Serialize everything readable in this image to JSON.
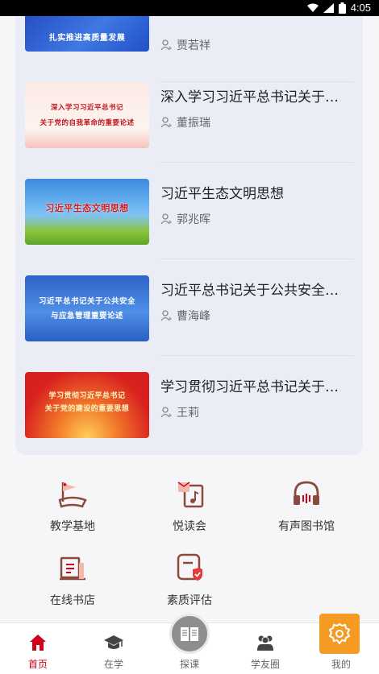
{
  "status": {
    "time": "4:05"
  },
  "articles": [
    {
      "thumb_text": [
        "扎实推进高质量发展"
      ],
      "title": "",
      "author": "贾若祥"
    },
    {
      "thumb_text": [
        "深入学习习近平总书记",
        "关于党的自我革命的重要论述"
      ],
      "title": "深入学习习近平总书记关于…",
      "author": "董振瑞"
    },
    {
      "thumb_text": [
        "习近平生态文明思想"
      ],
      "title": "习近平生态文明思想",
      "author": "郭兆晖"
    },
    {
      "thumb_text": [
        "习近平总书记关于公共安全",
        "与应急管理重要论述"
      ],
      "title": "习近平总书记关于公共安全…",
      "author": "曹海峰"
    },
    {
      "thumb_text": [
        "学习贯彻习近平总书记",
        "关于党的建设的重要思想"
      ],
      "title": "学习贯彻习近平总书记关于…",
      "author": "王莉"
    }
  ],
  "features": [
    {
      "label": "教学基地",
      "icon": "flag-map-icon"
    },
    {
      "label": "悦读会",
      "icon": "reading-club-icon"
    },
    {
      "label": "有声图书馆",
      "icon": "headphones-icon"
    },
    {
      "label": "在线书店",
      "icon": "bookstore-icon"
    },
    {
      "label": "素质评估",
      "icon": "shield-evaluation-icon"
    }
  ],
  "tabs": [
    {
      "label": "首页",
      "icon": "home-icon",
      "active": true
    },
    {
      "label": "在学",
      "icon": "graduation-cap-icon",
      "active": false
    },
    {
      "label": "探课",
      "icon": "book-icon",
      "active": false
    },
    {
      "label": "学友圈",
      "icon": "people-icon",
      "active": false
    },
    {
      "label": "我的",
      "icon": "settings-icon",
      "active": false
    }
  ],
  "colors": {
    "accent": "#d0021b",
    "fab": "#f59a23",
    "icon_brown": "#8b4a3c"
  }
}
